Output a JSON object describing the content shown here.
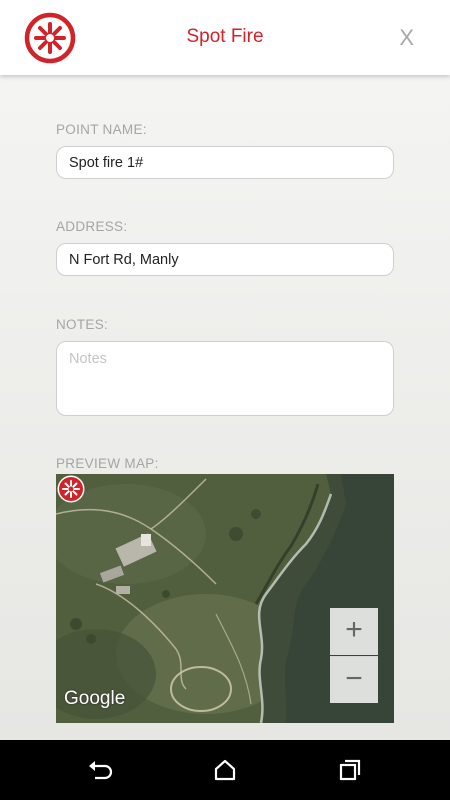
{
  "header": {
    "title": "Spot Fire",
    "close_label": "X"
  },
  "form": {
    "point_name_label": "POINT NAME:",
    "point_name_value": "Spot fire 1#",
    "address_label": "ADDRESS:",
    "address_value": "N Fort Rd, Manly",
    "notes_label": "NOTES:",
    "notes_value": "",
    "notes_placeholder": "Notes",
    "preview_map_label": "PREVIEW MAP:"
  },
  "map": {
    "attribution": "Google",
    "zoom_in_label": "+",
    "zoom_out_label": "−",
    "marker_icon": "fire-marker-icon"
  },
  "navbar": {
    "icons": [
      "back-icon",
      "home-icon",
      "recent-apps-icon"
    ]
  },
  "colors": {
    "accent": "#d0232a",
    "header_bg": "#ffffff",
    "navbar_bg": "#000000"
  }
}
